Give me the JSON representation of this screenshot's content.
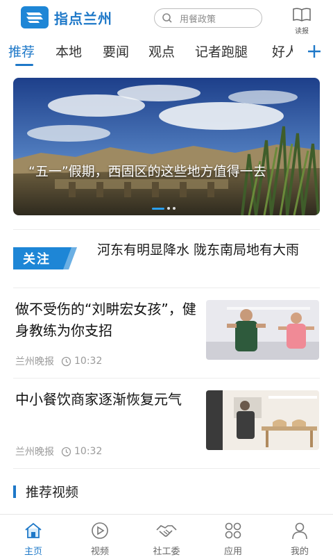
{
  "header": {
    "logo_text": "指点兰州",
    "search_placeholder": "用餐政策",
    "reader_label": "读报"
  },
  "tabs": [
    {
      "label": "推荐",
      "active": true
    },
    {
      "label": "本地",
      "active": false
    },
    {
      "label": "要闻",
      "active": false
    },
    {
      "label": "观点",
      "active": false
    },
    {
      "label": "记者跑腿",
      "active": false
    },
    {
      "label": "好人",
      "active": false
    }
  ],
  "banner": {
    "title": "“五一”假期，西固区的这些地方值得一去"
  },
  "attention": {
    "badge": "关注",
    "text": "河东有明显降水  陇东南局地有大雨"
  },
  "news": [
    {
      "title": "做不受伤的“刘畊宏女孩”，健身教练为你支招",
      "source": "兰州晚报",
      "time": "10:32"
    },
    {
      "title": "中小餐饮商家逐渐恢复元气",
      "source": "兰州晚报",
      "time": "10:32"
    }
  ],
  "section": {
    "title": "推荐视频"
  },
  "bottom_nav": [
    {
      "label": "主页",
      "icon": "home-icon",
      "active": true
    },
    {
      "label": "视频",
      "icon": "play-icon",
      "active": false
    },
    {
      "label": "社工委",
      "icon": "handshake-icon",
      "active": false
    },
    {
      "label": "应用",
      "icon": "apps-icon",
      "active": false
    },
    {
      "label": "我的",
      "icon": "user-icon",
      "active": false
    }
  ],
  "colors": {
    "brand": "#1e78c8",
    "accent": "#2aa0f0"
  }
}
